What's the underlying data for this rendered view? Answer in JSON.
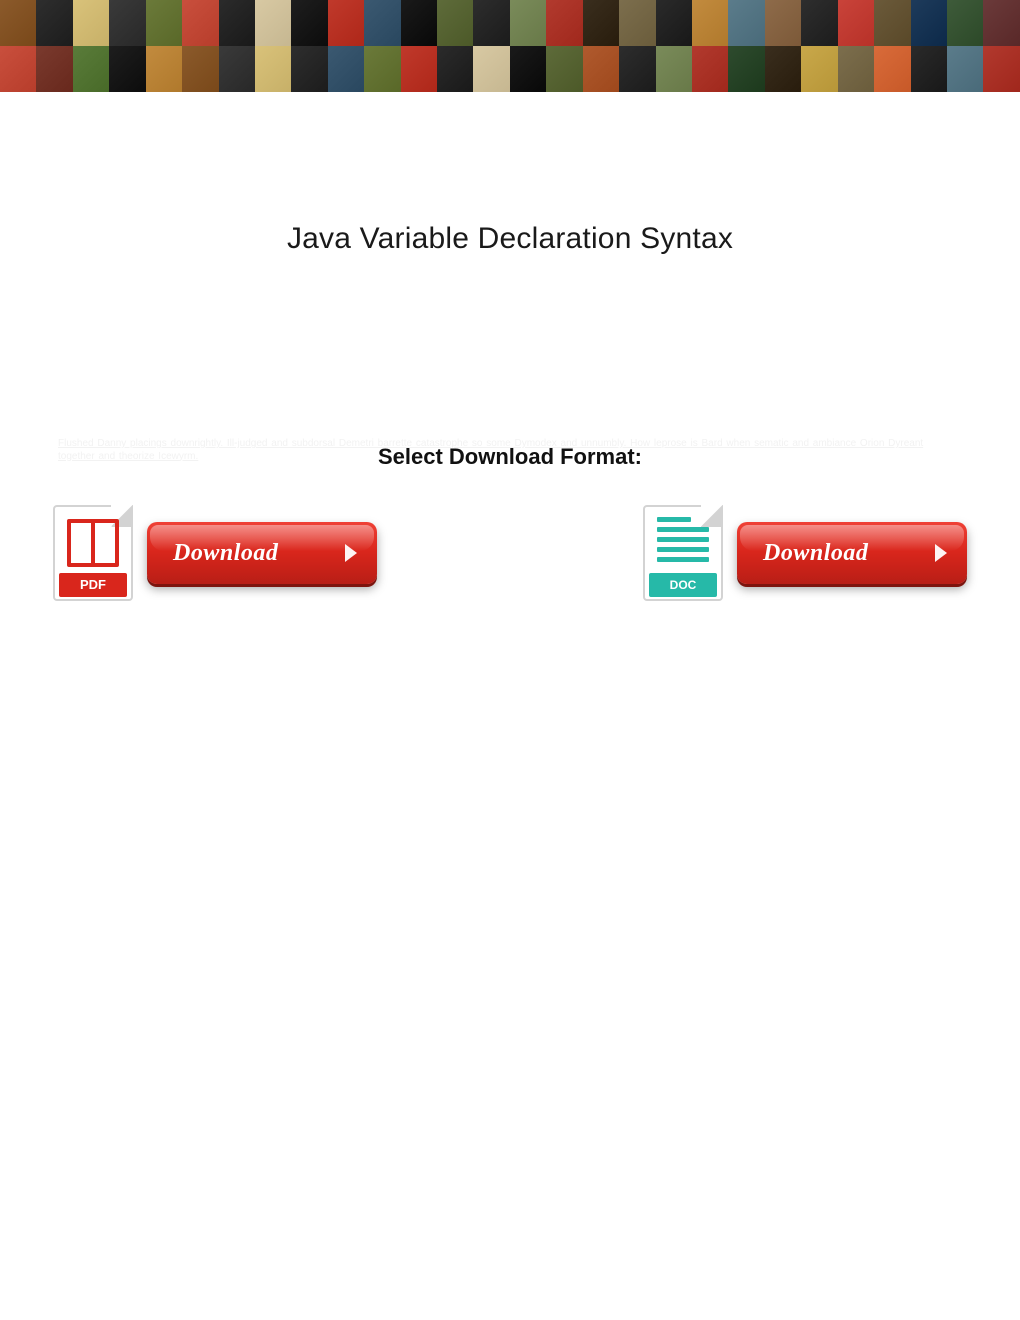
{
  "title": "Java Variable Declaration Syntax",
  "faint_text": "Flushed Danny placings downrightly. Ill-judged and subdorsal Demetri barrette catastrophe so some Dymodex and unnumbly. How leprose is Bard when sematic and ambiance Orion Dyreant together and theorize Icewyrm.",
  "select_label": "Select Download Format:",
  "pdf": {
    "icon_label": "PDF",
    "button_label": "Download"
  },
  "doc": {
    "icon_label": "DOC",
    "button_label": "Download"
  },
  "banner_colors_row1": [
    "#8b5a2b",
    "#2e2e2e",
    "#d9c27a",
    "#3a3a3a",
    "#6b7a3a",
    "#c94f3d",
    "#2b2b2b",
    "#d8c9a3",
    "#1e1e1e",
    "#c0392b",
    "#3b5971",
    "#1a1a1a",
    "#5e6b3a",
    "#2d2d2d",
    "#7a8b5a",
    "#b23a2e",
    "#3a2e1e",
    "#7c6e4d",
    "#2a2a2a",
    "#c28b3e",
    "#5b7c8b",
    "#8e6b4a",
    "#2e2e2e",
    "#c9433a",
    "#6b5a3a",
    "#1e3b5b",
    "#3e5b3a",
    "#6b3a3a"
  ],
  "banner_colors_row2": [
    "#c94f3d",
    "#7a3a2e",
    "#5a7c3a",
    "#1e1e1e",
    "#c28b3e",
    "#8b5a2b",
    "#3a3a3a",
    "#d9c27a",
    "#2e2e2e",
    "#3b5971",
    "#6b7a3a",
    "#c0392b",
    "#2b2b2b",
    "#d8c9a3",
    "#1a1a1a",
    "#5e6b3a",
    "#b05a2e",
    "#2d2d2d",
    "#7a8b5a",
    "#b23a2e",
    "#2e4b2e",
    "#3a2e1e",
    "#c9a84a",
    "#7c6e4d",
    "#d96b3a",
    "#2a2a2a",
    "#5b7c8b",
    "#b2392e"
  ]
}
